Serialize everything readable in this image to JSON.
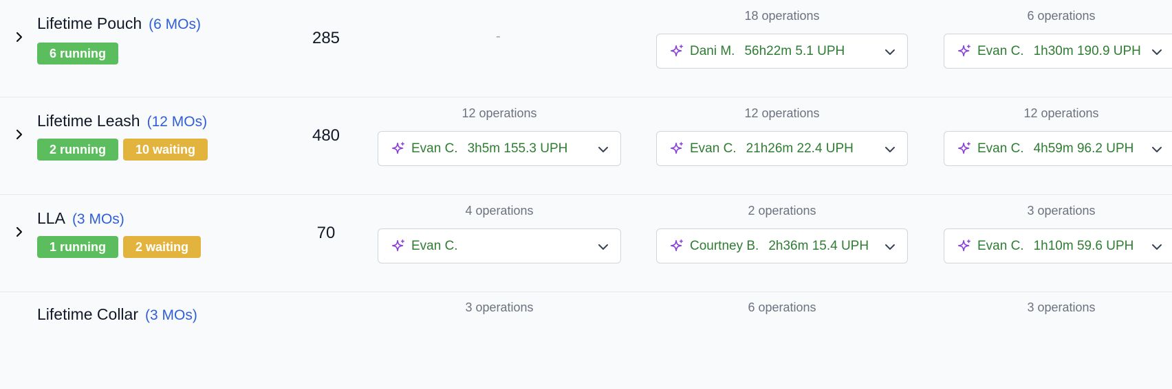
{
  "rows": [
    {
      "name": "Lifetime Pouch",
      "mos": "(6 MOs)",
      "badges": [
        {
          "label": "6 running",
          "type": "running"
        }
      ],
      "quantity": "285",
      "col1": {
        "empty": "-"
      },
      "col2": {
        "ops": "18 operations",
        "worker": "Dani M.",
        "metrics": "56h22m 5.1 UPH"
      },
      "col3": {
        "ops": "6 operations",
        "worker": "Evan C.",
        "metrics": "1h30m 190.9 UPH"
      }
    },
    {
      "name": "Lifetime Leash",
      "mos": "(12 MOs)",
      "badges": [
        {
          "label": "2 running",
          "type": "running"
        },
        {
          "label": "10 waiting",
          "type": "waiting"
        }
      ],
      "quantity": "480",
      "col1": {
        "ops": "12 operations",
        "worker": "Evan C.",
        "metrics": "3h5m 155.3 UPH"
      },
      "col2": {
        "ops": "12 operations",
        "worker": "Evan C.",
        "metrics": "21h26m 22.4 UPH"
      },
      "col3": {
        "ops": "12 operations",
        "worker": "Evan C.",
        "metrics": "4h59m 96.2 UPH"
      }
    },
    {
      "name": "LLA",
      "mos": "(3 MOs)",
      "badges": [
        {
          "label": "1 running",
          "type": "running"
        },
        {
          "label": "2 waiting",
          "type": "waiting"
        }
      ],
      "quantity": "70",
      "col1": {
        "ops": "4 operations",
        "worker": "Evan C.",
        "metrics": ""
      },
      "col2": {
        "ops": "2 operations",
        "worker": "Courtney B.",
        "metrics": "2h36m 15.4 UPH"
      },
      "col3": {
        "ops": "3 operations",
        "worker": "Evan C.",
        "metrics": "1h10m 59.6 UPH"
      }
    },
    {
      "name": "Lifetime Collar",
      "mos": "(3 MOs)",
      "col1": {
        "ops": "3 operations"
      },
      "col2": {
        "ops": "6 operations"
      },
      "col3": {
        "ops": "3 operations"
      }
    }
  ],
  "icons": {
    "expand": "chevron-right-icon",
    "assignee": "sparkle-icon",
    "dropdown": "chevron-down-icon"
  },
  "colors": {
    "running": "#5cbd5f",
    "waiting": "#e2b43d",
    "worker_text": "#2e7d32",
    "mo_link": "#2f5fd6",
    "sparkle": "#8b3fd9"
  }
}
